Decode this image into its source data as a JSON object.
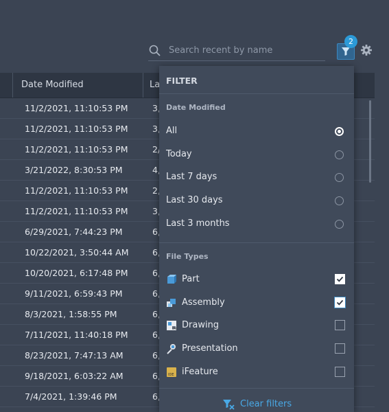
{
  "search": {
    "placeholder": "Search recent by name"
  },
  "filter_badge": "2",
  "table": {
    "headers": {
      "date_modified": "Date Modified",
      "last": "La"
    },
    "rows": [
      {
        "date": "11/2/2021, 11:10:53 PM",
        "last": "3,"
      },
      {
        "date": "11/2/2021, 11:10:53 PM",
        "last": "3,"
      },
      {
        "date": "11/2/2021, 11:10:53 PM",
        "last": "2/"
      },
      {
        "date": "3/21/2022, 8:30:53 PM",
        "last": "4,"
      },
      {
        "date": "11/2/2021, 11:10:53 PM",
        "last": "2,"
      },
      {
        "date": "11/2/2021, 11:10:53 PM",
        "last": "3,"
      },
      {
        "date": "6/29/2021, 7:44:23 PM",
        "last": "6,"
      },
      {
        "date": "10/22/2021, 3:50:44 AM",
        "last": "6,"
      },
      {
        "date": "10/20/2021, 6:17:48 PM",
        "last": "6,"
      },
      {
        "date": "9/11/2021, 6:59:43 PM",
        "last": "6,"
      },
      {
        "date": "8/3/2021, 1:58:55 PM",
        "last": "6,"
      },
      {
        "date": "7/11/2021, 11:40:18 PM",
        "last": "6,"
      },
      {
        "date": "8/23/2021, 7:47:13 AM",
        "last": "6,"
      },
      {
        "date": "9/18/2021, 6:03:22 AM",
        "last": "6,"
      },
      {
        "date": "7/4/2021, 1:39:46 PM",
        "last": "6,"
      }
    ]
  },
  "filter_panel": {
    "title": "FILTER",
    "date_section": "Date Modified",
    "date_options": [
      "All",
      "Today",
      "Last 7 days",
      "Last 30 days",
      "Last 3 months"
    ],
    "date_selected": "All",
    "types_section": "File Types",
    "file_types": [
      {
        "label": "Part",
        "icon": "part-icon",
        "checked": true
      },
      {
        "label": "Assembly",
        "icon": "assembly-icon",
        "checked": true
      },
      {
        "label": "Drawing",
        "icon": "drawing-icon",
        "checked": false
      },
      {
        "label": "Presentation",
        "icon": "presentation-icon",
        "checked": false
      },
      {
        "label": "iFeature",
        "icon": "ifeature-icon",
        "checked": false
      }
    ],
    "clear_label": "Clear filters"
  },
  "colors": {
    "accent": "#49a9e6",
    "badge": "#2c9ad7",
    "panel": "#404a5a",
    "background": "#3b4453"
  }
}
